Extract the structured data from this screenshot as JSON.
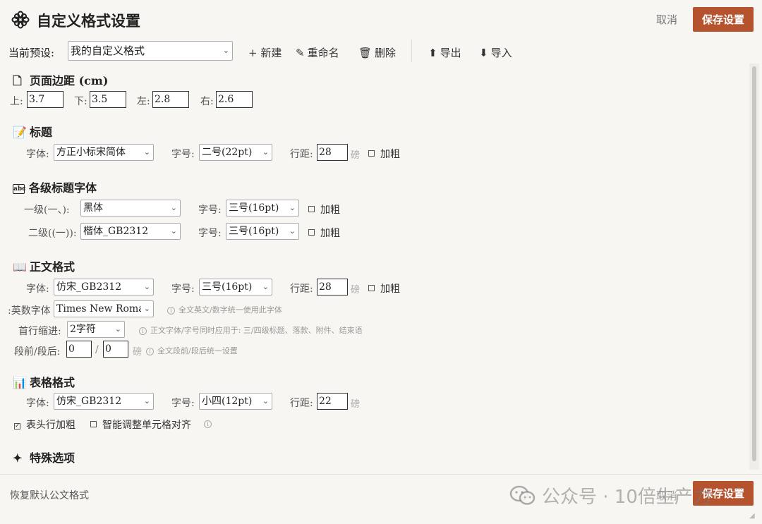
{
  "header": {
    "title": "自定义格式设置",
    "cancel_label": "取消",
    "save_label": "保存设置"
  },
  "preset": {
    "label": "当前预设:",
    "selected": "我的自定义格式",
    "actions": {
      "new": "+ 新建",
      "rename": "重命名",
      "delete": "删除",
      "export": "导出",
      "import": "导入"
    }
  },
  "margins": {
    "title": "页面边距 (cm)",
    "top_label": "上:",
    "top_value": "3.7",
    "bottom_label": "下:",
    "bottom_value": "3.5",
    "left_label": "左:",
    "left_value": "2.8",
    "right_label": "右:",
    "right_value": "2.6"
  },
  "heading": {
    "title": "标题",
    "font_label": "字体:",
    "font_value": "方正小标宋简体",
    "size_label": "字号:",
    "size_value": "二号(22pt)",
    "spacing_label": "行距:",
    "spacing_value": "28",
    "unit": "磅",
    "bold_label": "加粗"
  },
  "level_fonts": {
    "title": "各级标题字体",
    "l1_label": "一级(一、):",
    "l1_font": "黑体",
    "l1_size_label": "字号:",
    "l1_size": "三号(16pt)",
    "l1_bold": "加粗",
    "l2_label": "二级((一)):",
    "l2_font": "楷体_GB2312",
    "l2_size_label": "字号:",
    "l2_size": "三号(16pt)",
    "l2_bold": "加粗"
  },
  "body_format": {
    "title": "正文格式",
    "font_label": "字体:",
    "font_value": "仿宋_GB2312",
    "size_label": "字号:",
    "size_value": "三号(16pt)",
    "spacing_label": "行距:",
    "spacing_value": "28",
    "unit": "磅",
    "bold_label": "加粗",
    "en_font_label": "英数字体:",
    "en_font_value": "Times New Roman",
    "en_hint": "全文英文/数字统一使用此字体",
    "indent_label": "首行缩进:",
    "indent_value": "2字符",
    "indent_hint": "正文字体/字号同时应用于: 三/四级标题、落款、附件、结束语",
    "para_label": "段前/段后:",
    "para_before": "0",
    "para_after": "0",
    "para_sep": "/",
    "para_unit": "磅",
    "para_hint": "全文段前/段后统一设置"
  },
  "table_format": {
    "title": "表格格式",
    "font_label": "字体:",
    "font_value": "仿宋_GB2312",
    "size_label": "字号:",
    "size_value": "小四(12pt)",
    "spacing_label": "行距:",
    "spacing_value": "22",
    "unit": "磅",
    "header_bold_label": "表头行加粗",
    "smart_align_label": "智能调整单元格对齐"
  },
  "special": {
    "title": "特殊选项"
  },
  "footer": {
    "restore_label": "恢复默认公文格式",
    "cancel_label": "取消",
    "save_label": "保存设置"
  },
  "watermark": "公众号 · 10倍生产力",
  "colors": {
    "accent": "#b5532e",
    "background": "#f7f6f2"
  }
}
